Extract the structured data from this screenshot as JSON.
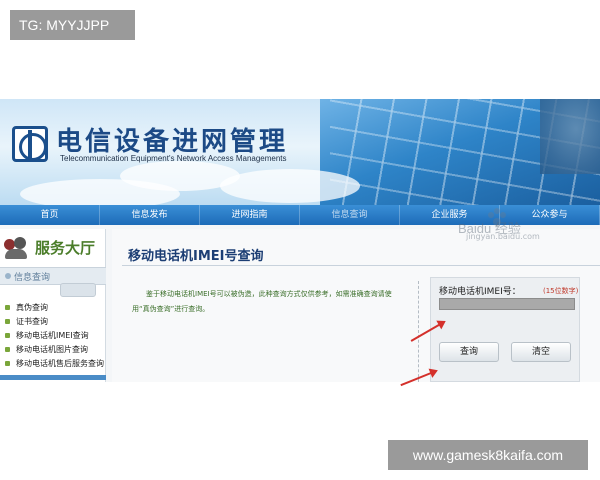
{
  "tag": "TG: MYYJJPP",
  "footer_tag": "www.gamesk8kaifa.com",
  "banner": {
    "title_cn": "电信设备进网管理",
    "title_en": "Telecommunication Equipment's Network Access Managements"
  },
  "nav": {
    "items": [
      "首页",
      "信息发布",
      "进网指南",
      "信息查询",
      "企业服务",
      "公众参与"
    ],
    "active_index": 3
  },
  "sidebar": {
    "title": "服务大厅",
    "section": "信息查询",
    "items": [
      "真伪查询",
      "证书查询",
      "移动电话机IMEI查询",
      "移动电话机图片查询",
      "移动电话机售后服务查询"
    ]
  },
  "main": {
    "page_title": "移动电话机IMEI号查询",
    "description": "鉴于移动电话机IMEI号可以被伪造，此种查询方式仅供参考，如需准确查询请使用“真伪查询”进行查询。",
    "form": {
      "imei_label": "移动电话机IMEI号：",
      "imei_hint": "(15位数字)",
      "imei_value": "",
      "query_button": "查询",
      "clear_button": "清空"
    }
  },
  "watermark": {
    "text": "Baidu 经验",
    "sub": "jingyan.baidu.com"
  },
  "colors": {
    "nav_blue": "#1d6bb8",
    "title_blue": "#1c3e74",
    "hint_red": "#c0392b",
    "arrow_red": "#d4302b",
    "sidebar_green": "#4b7d2a"
  }
}
